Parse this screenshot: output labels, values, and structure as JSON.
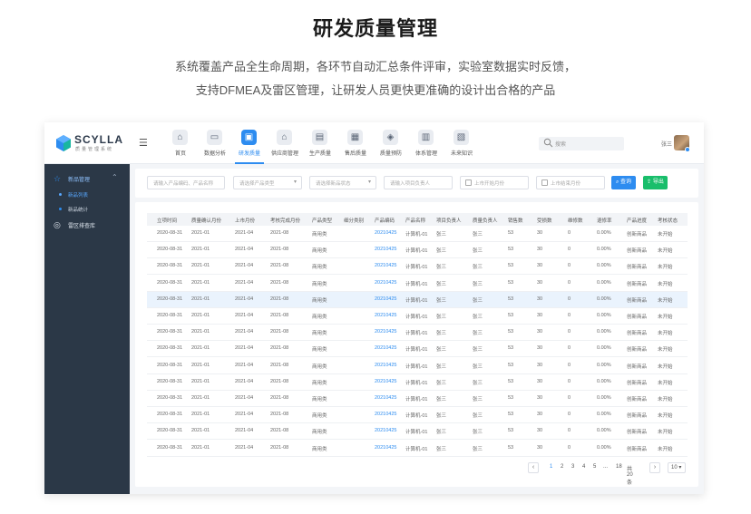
{
  "hero": {
    "title": "研发质量管理",
    "line1": "系统覆盖产品全生命周期，各环节自动汇总条件评审，实验室数据实时反馈，",
    "line2": "支持DFMEA及雷区管理，让研发人员更快更准确的设计出合格的产品"
  },
  "app": {
    "logo_name": "SCYLLA",
    "logo_tag": "质量管理系统",
    "nav": [
      {
        "label": "首页",
        "icon": "home-icon",
        "glyph": "⌂"
      },
      {
        "label": "数据分析",
        "icon": "chart-icon",
        "glyph": "▭"
      },
      {
        "label": "研发质量",
        "icon": "rd-icon",
        "glyph": "▣",
        "active": true
      },
      {
        "label": "供应商管理",
        "icon": "supplier-icon",
        "glyph": "⌂"
      },
      {
        "label": "生产质量",
        "icon": "production-icon",
        "glyph": "▤"
      },
      {
        "label": "售后质量",
        "icon": "aftersales-icon",
        "glyph": "▦"
      },
      {
        "label": "质量预防",
        "icon": "shield-icon",
        "glyph": "◈"
      },
      {
        "label": "体系管理",
        "icon": "system-icon",
        "glyph": "▥"
      },
      {
        "label": "未来知识",
        "icon": "knowledge-icon",
        "glyph": "▧"
      }
    ],
    "search_placeholder": "搜索",
    "user_name": "张三",
    "accent": "#2d8cf0",
    "sidebar": {
      "group1": "新品管理",
      "sub1": "新品列表",
      "sub2": "新品统计",
      "group2": "雷区排查库"
    },
    "filters": {
      "product": "请输入产品编码、产品名称",
      "type": "请选择产品类型",
      "status": "请选择新品状态",
      "owner": "请输入项目负责人",
      "start": "上市开始月份",
      "end": "上市结束月份",
      "query": "查询",
      "export": "导出"
    },
    "table": {
      "headers": [
        "立项时间",
        "质量确认月份",
        "上市月份",
        "考核完成月份",
        "产品类型",
        "细分类别",
        "产品编码",
        "产品名称",
        "项目负责人",
        "质量负责人",
        "销售数",
        "受损数",
        "维修数",
        "退修率",
        "产品进度",
        "考核状态"
      ],
      "rows": [
        [
          "2020-08-31",
          "2021-01",
          "2021-04",
          "2021-08",
          "商用类",
          "",
          "20210425",
          "计算机-01",
          "张三",
          "张三",
          "53",
          "30",
          "0",
          "0.00%",
          "创新商品",
          "未开始"
        ],
        [
          "2020-08-31",
          "2021-01",
          "2021-04",
          "2021-08",
          "商用类",
          "",
          "20210425",
          "计算机-01",
          "张三",
          "张三",
          "53",
          "30",
          "0",
          "0.00%",
          "创新商品",
          "未开始"
        ],
        [
          "2020-08-31",
          "2021-01",
          "2021-04",
          "2021-08",
          "商用类",
          "",
          "20210425",
          "计算机-01",
          "张三",
          "张三",
          "53",
          "30",
          "0",
          "0.00%",
          "创新商品",
          "未开始"
        ],
        [
          "2020-08-31",
          "2021-01",
          "2021-04",
          "2021-08",
          "商用类",
          "",
          "20210425",
          "计算机-01",
          "张三",
          "张三",
          "53",
          "30",
          "0",
          "0.00%",
          "创新商品",
          "未开始"
        ],
        [
          "2020-08-31",
          "2021-01",
          "2021-04",
          "2021-08",
          "商用类",
          "",
          "20210425",
          "计算机-01",
          "张三",
          "张三",
          "53",
          "30",
          "0",
          "0.00%",
          "创新商品",
          "未开始"
        ],
        [
          "2020-08-31",
          "2021-01",
          "2021-04",
          "2021-08",
          "商用类",
          "",
          "20210425",
          "计算机-01",
          "张三",
          "张三",
          "53",
          "30",
          "0",
          "0.00%",
          "创新商品",
          "未开始"
        ],
        [
          "2020-08-31",
          "2021-01",
          "2021-04",
          "2021-08",
          "商用类",
          "",
          "20210425",
          "计算机-01",
          "张三",
          "张三",
          "53",
          "30",
          "0",
          "0.00%",
          "创新商品",
          "未开始"
        ],
        [
          "2020-08-31",
          "2021-01",
          "2021-04",
          "2021-08",
          "商用类",
          "",
          "20210425",
          "计算机-01",
          "张三",
          "张三",
          "53",
          "30",
          "0",
          "0.00%",
          "创新商品",
          "未开始"
        ],
        [
          "2020-08-31",
          "2021-01",
          "2021-04",
          "2021-08",
          "商用类",
          "",
          "20210425",
          "计算机-01",
          "张三",
          "张三",
          "53",
          "30",
          "0",
          "0.00%",
          "创新商品",
          "未开始"
        ],
        [
          "2020-08-31",
          "2021-01",
          "2021-04",
          "2021-08",
          "商用类",
          "",
          "20210425",
          "计算机-01",
          "张三",
          "张三",
          "53",
          "30",
          "0",
          "0.00%",
          "创新商品",
          "未开始"
        ],
        [
          "2020-08-31",
          "2021-01",
          "2021-04",
          "2021-08",
          "商用类",
          "",
          "20210425",
          "计算机-01",
          "张三",
          "张三",
          "53",
          "30",
          "0",
          "0.00%",
          "创新商品",
          "未开始"
        ],
        [
          "2020-08-31",
          "2021-01",
          "2021-04",
          "2021-08",
          "商用类",
          "",
          "20210425",
          "计算机-01",
          "张三",
          "张三",
          "53",
          "30",
          "0",
          "0.00%",
          "创新商品",
          "未开始"
        ],
        [
          "2020-08-31",
          "2021-01",
          "2021-04",
          "2021-08",
          "商用类",
          "",
          "20210425",
          "计算机-01",
          "张三",
          "张三",
          "53",
          "30",
          "0",
          "0.00%",
          "创新商品",
          "未开始"
        ],
        [
          "2020-08-31",
          "2021-01",
          "2021-04",
          "2021-08",
          "商用类",
          "",
          "20210425",
          "计算机-01",
          "张三",
          "张三",
          "53",
          "30",
          "0",
          "0.00%",
          "创新商品",
          "未开始"
        ]
      ],
      "highlight_row": 4
    },
    "pager": {
      "prev": "‹",
      "pages": [
        "1",
        "2",
        "3",
        "4",
        "5"
      ],
      "ellipsis": "...",
      "last": "18",
      "total": "共20条",
      "next": "›",
      "size": "10"
    }
  }
}
